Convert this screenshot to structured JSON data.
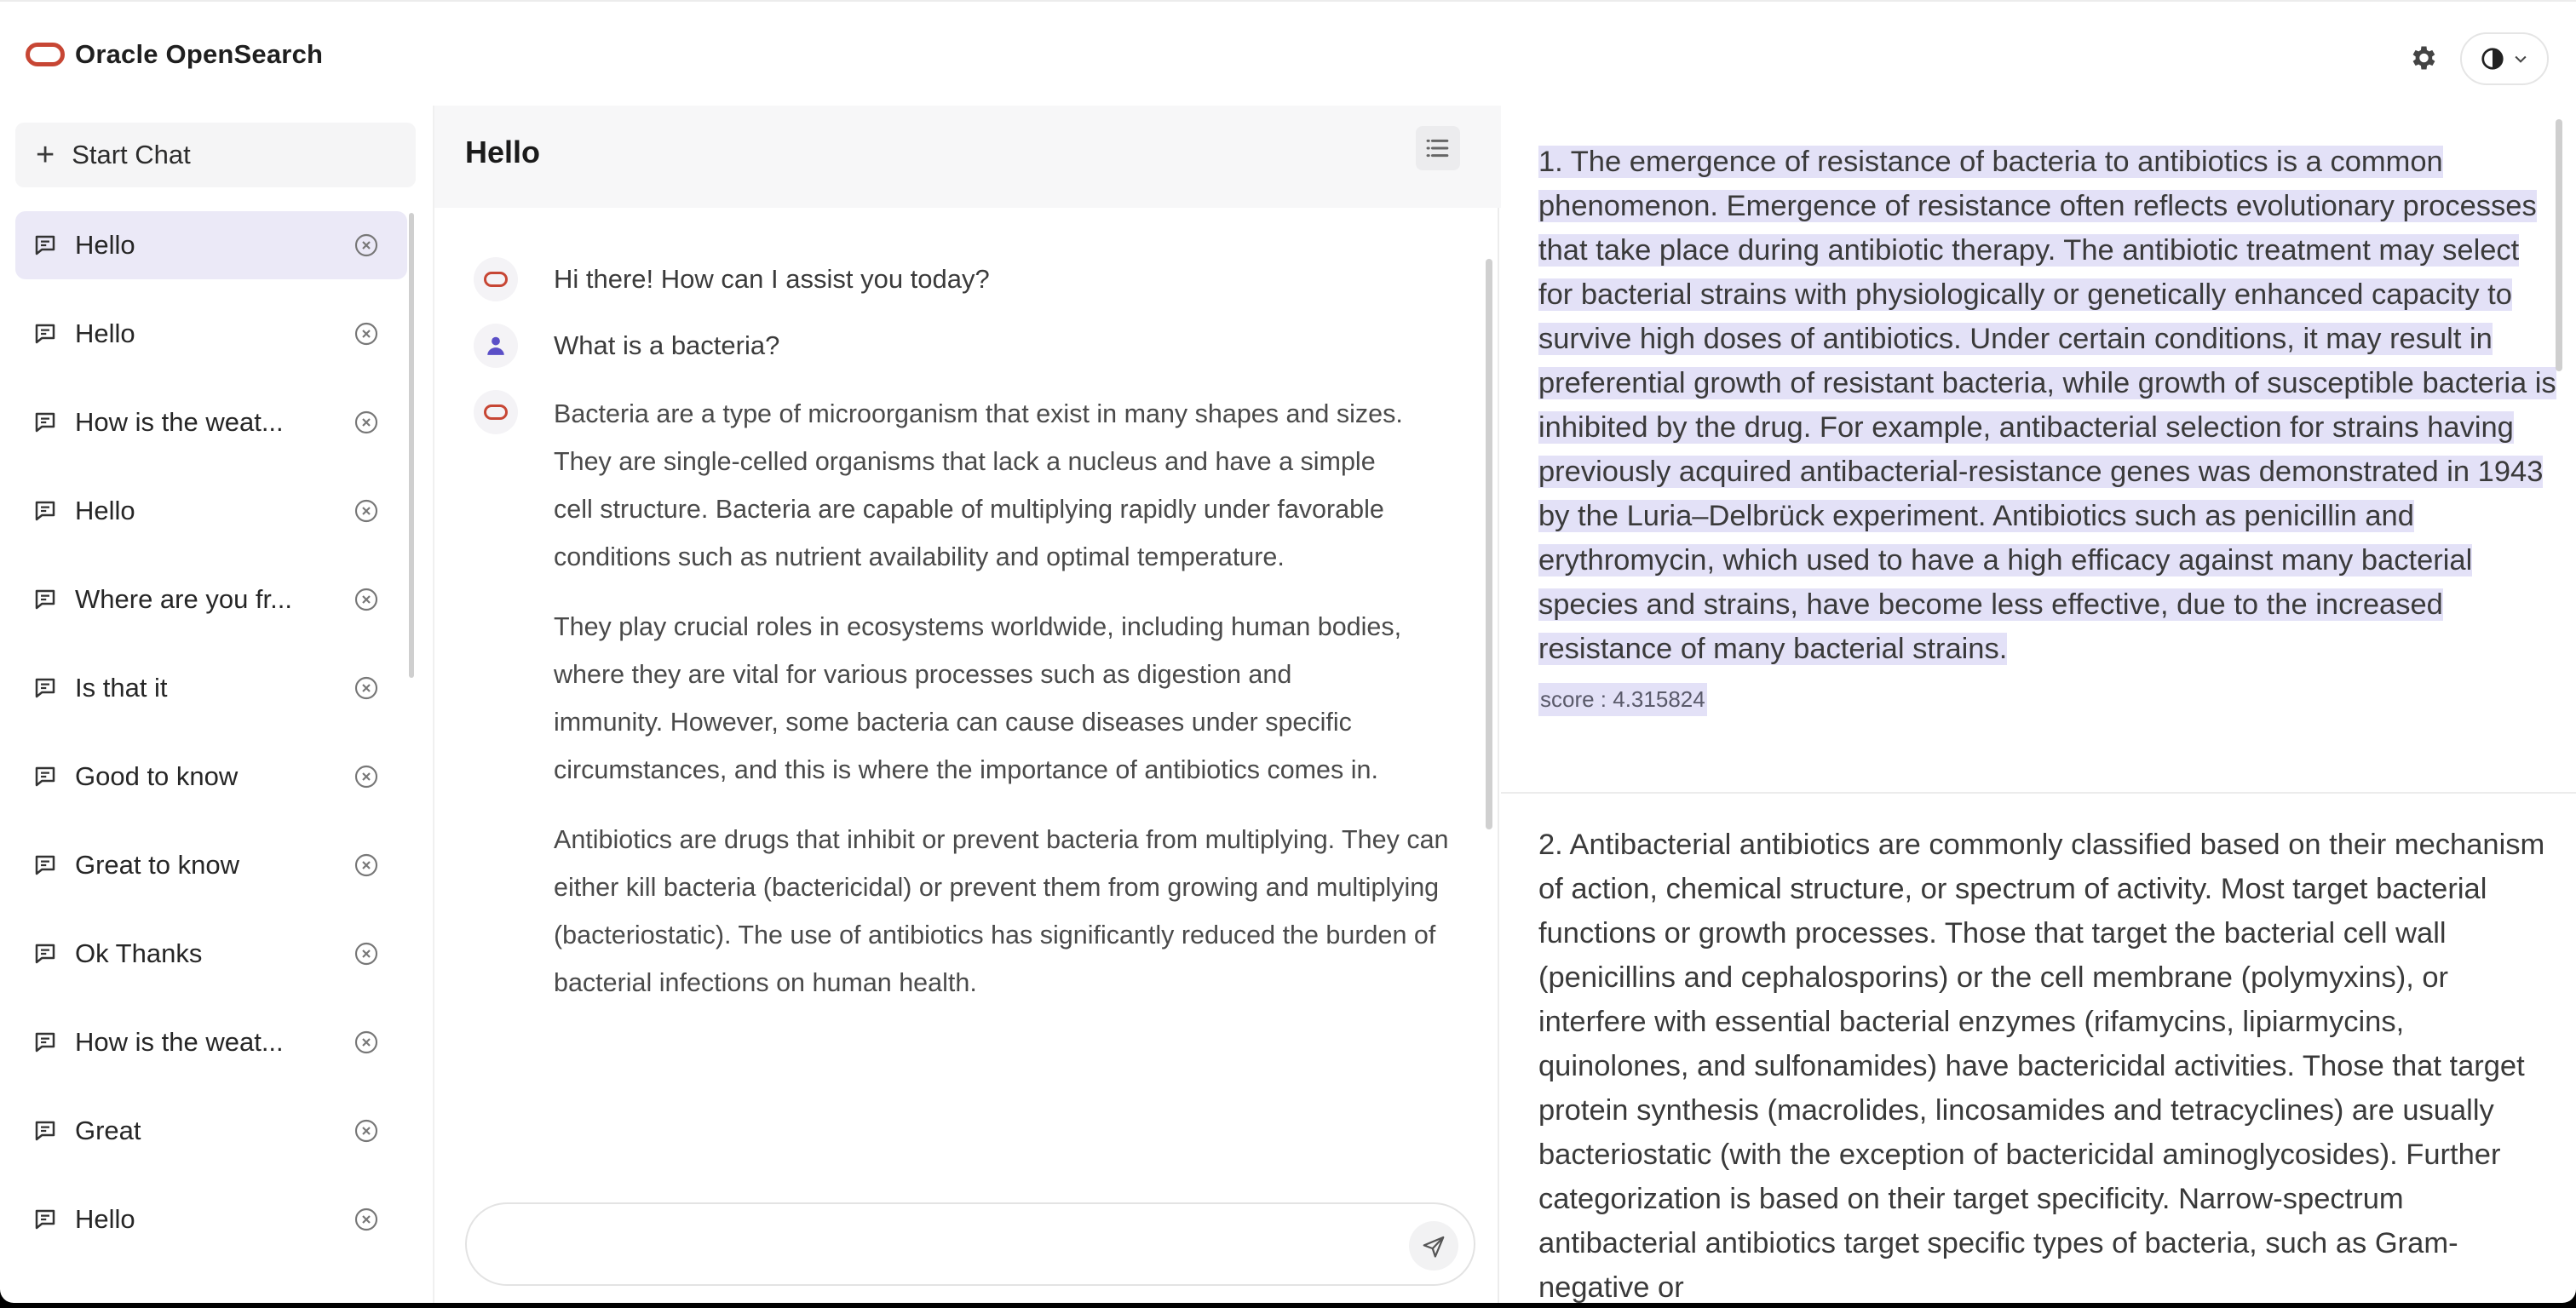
{
  "app": {
    "brand_name": "Oracle OpenSearch",
    "brand_color": "#c74634"
  },
  "sidebar": {
    "start_chat_label": "Start Chat",
    "items": [
      {
        "title": "Hello",
        "active": true
      },
      {
        "title": "Hello"
      },
      {
        "title": "How is the weat..."
      },
      {
        "title": "Hello"
      },
      {
        "title": "Where are you fr..."
      },
      {
        "title": "Is that it"
      },
      {
        "title": "Good to know"
      },
      {
        "title": "Great to know"
      },
      {
        "title": "Ok Thanks"
      },
      {
        "title": "How is the weat..."
      },
      {
        "title": "Great"
      },
      {
        "title": "Hello"
      }
    ]
  },
  "chat": {
    "title": "Hello",
    "messages": [
      {
        "role": "assistant",
        "text": "Hi there! How can I assist you today?"
      },
      {
        "role": "user",
        "text": "What is a bacteria?"
      },
      {
        "role": "assistant",
        "paragraphs": [
          "Bacteria are a type of microorganism that exist in many shapes and sizes. They are single-celled organisms that lack a nucleus and have a simple cell structure. Bacteria are capable of multiplying rapidly under favorable conditions such as nutrient availability and optimal temperature.",
          "They play crucial roles in ecosystems worldwide, including human bodies, where they are vital for various processes such as digestion and immunity. However, some bacteria can cause diseases under specific circumstances, and this is where the importance of antibiotics comes in.",
          "Antibiotics are drugs that inhibit or prevent bacteria from multiplying. They can either kill bacteria (bactericidal) or prevent them from growing and multiplying (bacteriostatic). The use of antibiotics has significantly reduced the burden of bacterial infections on human health."
        ]
      }
    ],
    "input_value": ""
  },
  "results": [
    {
      "text": "1. The emergence of resistance of bacteria to antibiotics is a common phenomenon. Emergence of resistance often reflects evolutionary processes that take place during antibiotic therapy. The antibiotic treatment may select for bacterial strains with physiologically or genetically enhanced capacity to survive high doses of antibiotics. Under certain conditions, it may result in preferential growth of resistant bacteria, while growth of susceptible bacteria is inhibited by the drug. For example, antibacterial selection for strains having previously acquired antibacterial-resistance genes was demonstrated in 1943 by the Luria–Delbrück experiment. Antibiotics such as penicillin and erythromycin, which used to have a high efficacy against many bacterial species and strains, have become less effective, due to the increased resistance of many bacterial strains.",
      "score": "score : 4.315824",
      "highlighted": true
    },
    {
      "text": "2. Antibacterial antibiotics are commonly classified based on their mechanism of action, chemical structure, or spectrum of activity. Most target bacterial functions or growth processes. Those that target the bacterial cell wall (penicillins and cephalosporins) or the cell membrane (polymyxins), or interfere with essential bacterial enzymes (rifamycins, lipiarmycins, quinolones, and sulfonamides) have bactericidal activities. Those that target protein synthesis (macrolides, lincosamides and tetracyclines) are usually bacteriostatic (with the exception of bactericidal aminoglycosides). Further categorization is based on their target specificity. Narrow-spectrum antibacterial antibiotics target specific types of bacteria, such as Gram-negative or",
      "highlighted": false
    }
  ],
  "icons": {
    "gear": "gear-icon",
    "theme": "contrast-icon",
    "chat": "chat-bubble-icon",
    "close": "close-circle-icon",
    "send": "send-icon",
    "list": "list-icon"
  },
  "colors": {
    "highlight": "#e3e1f7",
    "active_item": "#ebe9f7",
    "user_avatar": "#5b4fc7"
  }
}
